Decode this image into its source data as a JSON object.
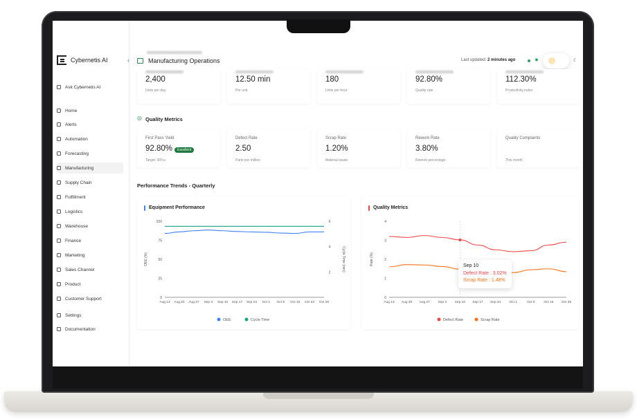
{
  "app": {
    "brand": "Cybernetis AI",
    "collapse_icon": "chevron-left-icon"
  },
  "sidebar": {
    "items": [
      {
        "label": "Ask Cybernetis AI",
        "icon": "chat-icon"
      },
      {
        "label": "Home",
        "icon": "home-icon"
      },
      {
        "label": "Alerts",
        "icon": "bell-icon"
      },
      {
        "label": "Automation",
        "icon": "automation-icon"
      },
      {
        "label": "Forecasting",
        "icon": "trend-icon"
      },
      {
        "label": "Manufacturing",
        "icon": "factory-icon",
        "active": true
      },
      {
        "label": "Supply Chain",
        "icon": "link-icon"
      },
      {
        "label": "Fulfillment",
        "icon": "box-icon"
      },
      {
        "label": "Logistics",
        "icon": "truck-icon"
      },
      {
        "label": "Warehouse",
        "icon": "warehouse-icon"
      },
      {
        "label": "Finance",
        "icon": "dollar-icon"
      },
      {
        "label": "Marketing",
        "icon": "megaphone-icon"
      },
      {
        "label": "Sales Channel",
        "icon": "cart-icon"
      },
      {
        "label": "Product",
        "icon": "bulb-icon"
      },
      {
        "label": "Customer Support",
        "icon": "headset-icon"
      },
      {
        "label": "Settings",
        "icon": "gear-icon"
      },
      {
        "label": "Documentation",
        "icon": "book-icon"
      }
    ]
  },
  "header": {
    "title": "Manufacturing Operations",
    "updated_prefix": "Last updated:",
    "updated_value": "2 minutes ago"
  },
  "kpis_top": [
    {
      "value": "2,400",
      "sub": "Units per day"
    },
    {
      "value": "12.50 min",
      "sub": "Per unit"
    },
    {
      "value": "180",
      "sub": "Units per hour"
    },
    {
      "value": "92.80%",
      "sub": "Quality rate"
    },
    {
      "value": "112.30%",
      "sub": "Productivity index"
    }
  ],
  "quality_section": {
    "title": "Quality Metrics",
    "cards": [
      {
        "label": "First Pass Yield",
        "value": "92.80%",
        "badge": "Excellent",
        "sub": "Target: 90%+"
      },
      {
        "label": "Defect Rate",
        "value": "2.50",
        "sub": "Parts per million"
      },
      {
        "label": "Scrap Rate",
        "value": "1.20%",
        "sub": "Material waste"
      },
      {
        "label": "Rework Rate",
        "value": "3.80%",
        "sub": "Rework percentage"
      },
      {
        "label": "Quality Complaints",
        "value": "",
        "sub": "This month"
      }
    ]
  },
  "trends_title": "Performance Trends - Quarterly",
  "colors": {
    "oee": "#3b82f6",
    "cycle": "#10a37f",
    "defect": "#ef4444",
    "scrap": "#f97316",
    "accent_green": "#1f7a3f"
  },
  "tooltip": {
    "date": "Sep 10",
    "defect": "Defect Rate : 3.02%",
    "scrap": "Scrap Rate : 1.48%"
  },
  "chart_data": [
    {
      "type": "line",
      "title": "Equipment Performance",
      "categories": [
        "Aug 13",
        "Aug 20",
        "Aug 27",
        "Sep 3",
        "Sep 10",
        "Sep 17",
        "Sep 24",
        "Oct 1",
        "Oct 8",
        "Oct 15",
        "Oct 22",
        "Oct 29"
      ],
      "ylabel": "OEE (%)",
      "y2label": "Cycle Time (min)",
      "ylim": [
        0,
        100
      ],
      "y2lim": [
        0,
        6
      ],
      "yticks": [
        0,
        25,
        50,
        75,
        100
      ],
      "y2ticks": [
        2,
        4,
        6
      ],
      "series": [
        {
          "name": "OEE",
          "axis": "left",
          "values": [
            84,
            86,
            87.5,
            88.5,
            87.5,
            86.5,
            86,
            85.5,
            84.5,
            84,
            86,
            86
          ]
        },
        {
          "name": "Cycle Time",
          "axis": "right",
          "values": [
            5.6,
            5.6,
            5.6,
            5.6,
            5.6,
            5.6,
            5.6,
            5.6,
            5.6,
            5.6,
            5.6,
            5.6
          ]
        }
      ],
      "legend_position": "bottom",
      "grid": false
    },
    {
      "type": "line",
      "title": "Quality Metrics",
      "categories": [
        "Aug 13",
        "Aug 20",
        "Aug 27",
        "Sep 3",
        "Sep 10",
        "Sep 17",
        "Sep 24",
        "Oct 1",
        "Oct 8",
        "Oct 15",
        "Oct 29"
      ],
      "ylabel": "Rate (%)",
      "ylim": [
        0,
        4
      ],
      "yticks": [
        0,
        1,
        2,
        3,
        4
      ],
      "series": [
        {
          "name": "Defect Rate",
          "values": [
            3.2,
            3.15,
            3.25,
            3.15,
            3.02,
            2.75,
            2.5,
            2.4,
            2.45,
            2.75,
            2.9
          ]
        },
        {
          "name": "Scrap Rate",
          "values": [
            1.6,
            1.72,
            1.7,
            1.62,
            1.48,
            1.3,
            1.25,
            1.3,
            1.45,
            1.5,
            1.35
          ]
        }
      ],
      "legend_position": "bottom",
      "grid": false
    }
  ]
}
